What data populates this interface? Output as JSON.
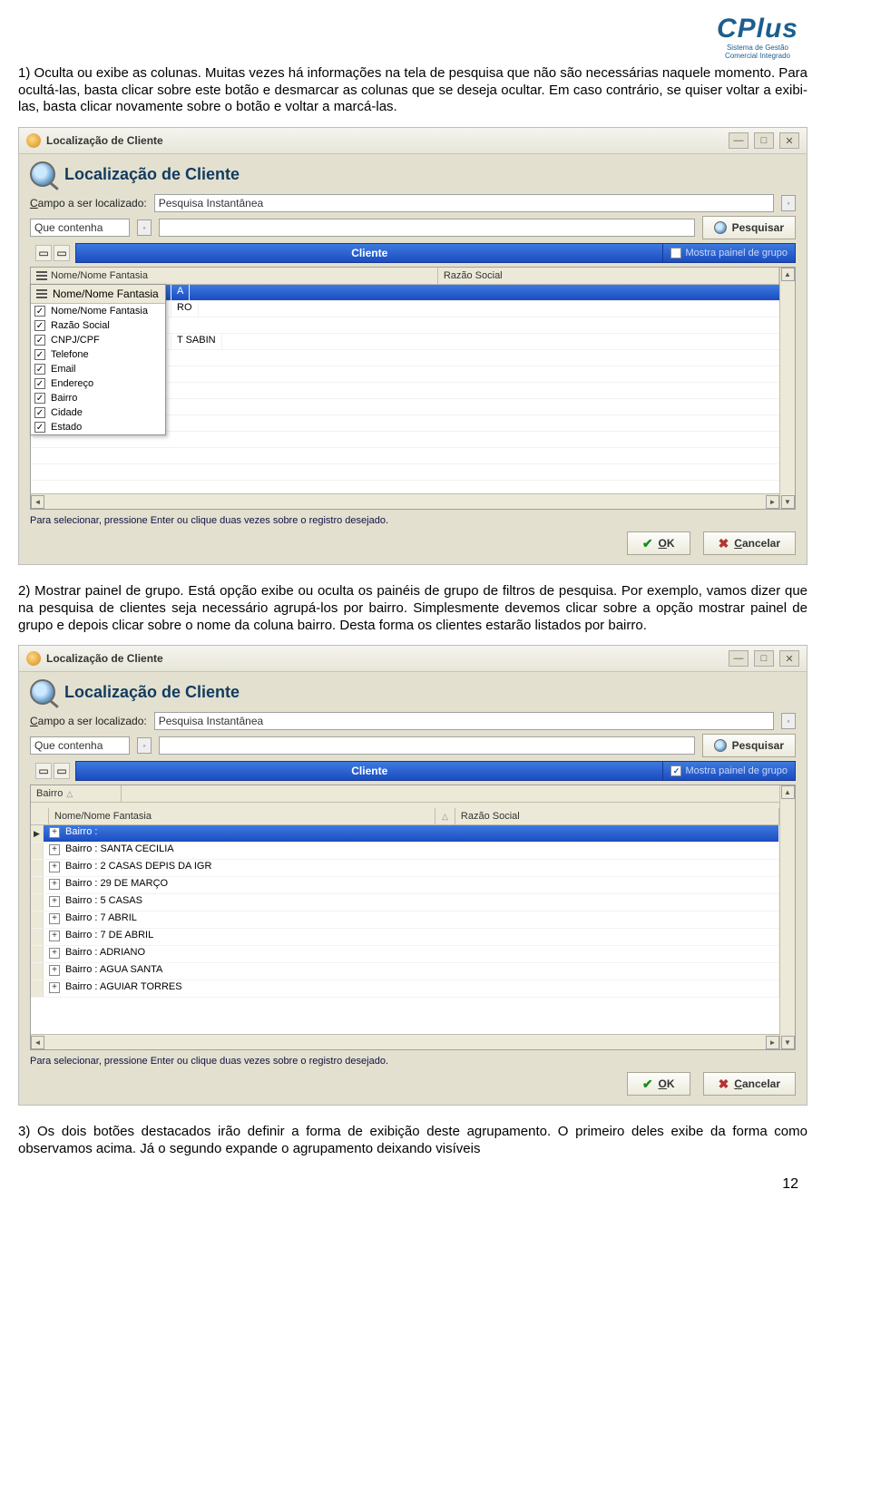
{
  "logo": {
    "brand": "CPlus",
    "sub1": "Sistema de Gestão",
    "sub2": "Comercial Integrado"
  },
  "item1": {
    "num": "1)",
    "text": "Oculta ou exibe as colunas. Muitas vezes há informações na tela de pesquisa que não são necessárias naquele momento. Para ocultá-las, basta clicar sobre este botão e desmarcar as colunas que se deseja ocultar. Em caso contrário, se quiser voltar a exibi-las, basta clicar novamente sobre o botão e voltar a marcá-las."
  },
  "item2": {
    "num": "2)",
    "text": "Mostrar painel de grupo. Está opção exibe ou oculta os painéis de grupo de filtros de pesquisa. Por exemplo, vamos dizer que na pesquisa de clientes seja necessário agrupá-los por bairro. Simplesmente devemos clicar sobre a opção mostrar painel de grupo e depois clicar sobre o nome da coluna bairro. Desta forma os clientes estarão listados por bairro."
  },
  "item3": {
    "num": "3)",
    "text": "Os dois botões destacados irão definir a forma de exibição deste agrupamento. O primeiro deles exibe da forma como observamos acima. Já o segundo expande o agrupamento deixando visíveis"
  },
  "win": {
    "title": "Localização de Cliente",
    "header": "Localização de Cliente",
    "campo_label_pre": "C",
    "campo_label_post": "ampo a ser localizado:",
    "campo_value": "Pesquisa Instantânea",
    "quecontenha": "Que contenha",
    "pesquisar": "Pesquisar",
    "tab": "Cliente",
    "showpanel": "Mostra painel de grupo",
    "col1": "Nome/Nome Fantasia",
    "col2": "Razão Social",
    "hint": "Para selecionar, pressione Enter ou clique duas vezes sobre o registro desejado.",
    "ok_u": "O",
    "ok_r": "K",
    "cancel_u": "C",
    "cancel_r": "ancelar"
  },
  "dropdown": {
    "head": "Nome/Nome Fantasia",
    "items": [
      "Nome/Nome Fantasia",
      "Razão Social",
      "CNPJ/CPF",
      "Telefone",
      "Email",
      "Endereço",
      "Bairro",
      "Cidade",
      "Estado"
    ]
  },
  "grid1_rows": {
    "sel": "A",
    "r1": "RO",
    "r2": "T SABIN"
  },
  "group": {
    "bairro": "Bairro",
    "header_sel": "Bairro :",
    "rows": [
      "Bairro : SANTA CECILIA",
      "Bairro : 2 CASAS DEPIS DA IGR",
      "Bairro : 29 DE MARÇO",
      "Bairro : 5 CASAS",
      "Bairro : 7 ABRIL",
      "Bairro : 7 DE ABRIL",
      "Bairro : ADRIANO",
      "Bairro : AGUA SANTA",
      "Bairro : AGUIAR TORRES"
    ]
  },
  "page_number": "12"
}
